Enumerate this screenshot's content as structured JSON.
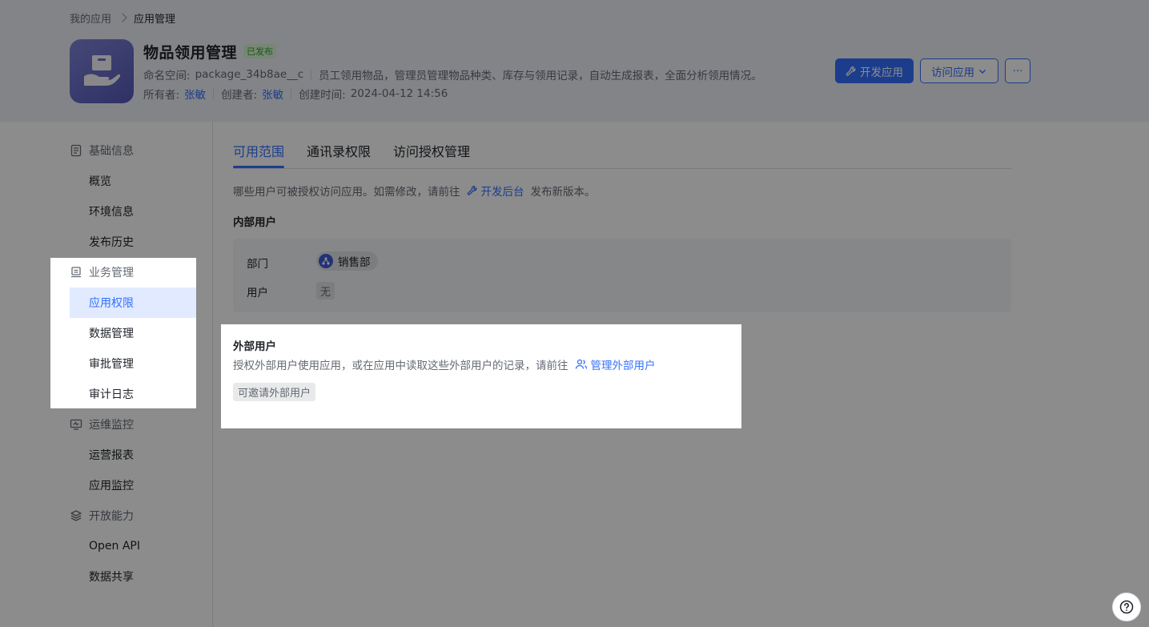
{
  "breadcrumb": {
    "parent": "我的应用",
    "current": "应用管理"
  },
  "app": {
    "title": "物品领用管理",
    "status": "已发布",
    "namespace_label": "命名空间:",
    "namespace": "package_34b8ae__c",
    "description": "员工领用物品，管理员管理物品种类、库存与领用记录，自动生成报表，全面分析领用情况。",
    "owner_label": "所有者:",
    "owner": "张敏",
    "creator_label": "创建者:",
    "creator": "张敏",
    "created_label": "创建时间:",
    "created_time": "2024-04-12 14:56"
  },
  "actions": {
    "develop": "开发应用",
    "visit": "访问应用",
    "more": "···"
  },
  "sidebar": {
    "groups": [
      {
        "label": "基础信息",
        "icon": "document-icon"
      },
      {
        "label": "业务管理",
        "icon": "business-icon"
      },
      {
        "label": "运维监控",
        "icon": "monitor-icon"
      },
      {
        "label": "开放能力",
        "icon": "layers-icon"
      }
    ],
    "items": [
      "概览",
      "环境信息",
      "发布历史",
      "应用权限",
      "数据管理",
      "审批管理",
      "审计日志",
      "运营报表",
      "应用监控",
      "Open API",
      "数据共享"
    ],
    "active": "应用权限"
  },
  "tabs": [
    "可用范围",
    "通讯录权限",
    "访问授权管理"
  ],
  "active_tab": "可用范围",
  "content": {
    "desc_prefix": "哪些用户可被授权访问应用。如需修改，请前往",
    "desc_link": "开发后台",
    "desc_suffix": "发布新版本。",
    "internal_title": "内部用户",
    "dept_label": "部门",
    "dept_value": "销售部",
    "user_label": "用户",
    "user_value": "无",
    "external_title": "外部用户",
    "external_desc": "授权外部用户使用应用，或在应用中读取这些外部用户的记录，请前往",
    "external_link": "管理外部用户",
    "invite_tag": "可邀请外部用户"
  },
  "colors": {
    "accent": "#3370ff",
    "overlay": "rgba(0,0,0,0.45)"
  },
  "help_icon": "help-icon"
}
